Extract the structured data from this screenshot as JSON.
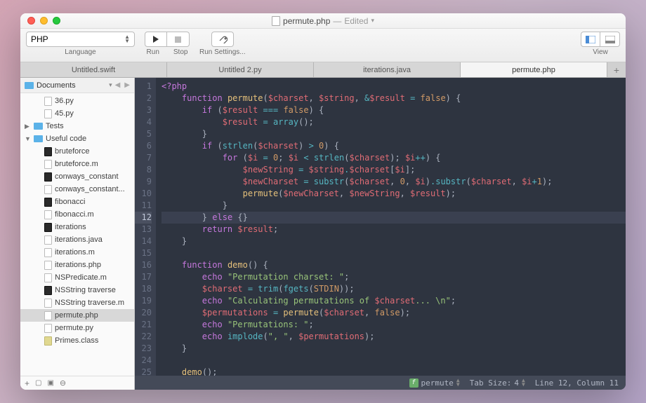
{
  "window": {
    "filename": "permute.php",
    "edited_label": "Edited"
  },
  "toolbar": {
    "language": {
      "selected": "PHP",
      "label": "Language"
    },
    "run": {
      "label": "Run"
    },
    "stop": {
      "label": "Stop"
    },
    "run_settings": {
      "label": "Run Settings..."
    },
    "view": {
      "label": "View"
    }
  },
  "tabs": [
    {
      "label": "Untitled.swift",
      "active": false
    },
    {
      "label": "Untitled 2.py",
      "active": false
    },
    {
      "label": "iterations.java",
      "active": false
    },
    {
      "label": "permute.php",
      "active": true
    }
  ],
  "sidebar": {
    "root": "Documents",
    "items": [
      {
        "label": "36.py",
        "type": "doc",
        "depth": 2
      },
      {
        "label": "45.py",
        "type": "doc",
        "depth": 2
      },
      {
        "label": "Tests",
        "type": "folder",
        "depth": 1,
        "expanded": false
      },
      {
        "label": "Useful code",
        "type": "folder",
        "depth": 1,
        "expanded": true
      },
      {
        "label": "bruteforce",
        "type": "exec",
        "depth": 2
      },
      {
        "label": "bruteforce.m",
        "type": "doc",
        "depth": 2
      },
      {
        "label": "conways_constant",
        "type": "exec",
        "depth": 2
      },
      {
        "label": "conways_constant...",
        "type": "doc",
        "depth": 2
      },
      {
        "label": "fibonacci",
        "type": "exec",
        "depth": 2
      },
      {
        "label": "fibonacci.m",
        "type": "doc",
        "depth": 2
      },
      {
        "label": "iterations",
        "type": "exec",
        "depth": 2
      },
      {
        "label": "iterations.java",
        "type": "doc",
        "depth": 2
      },
      {
        "label": "iterations.m",
        "type": "doc",
        "depth": 2
      },
      {
        "label": "iterations.php",
        "type": "doc",
        "depth": 2
      },
      {
        "label": "NSPredicate.m",
        "type": "doc",
        "depth": 2
      },
      {
        "label": "NSString traverse",
        "type": "exec",
        "depth": 2
      },
      {
        "label": "NSString traverse.m",
        "type": "doc",
        "depth": 2
      },
      {
        "label": "permute.php",
        "type": "doc",
        "depth": 2,
        "selected": true
      },
      {
        "label": "permute.py",
        "type": "doc",
        "depth": 2
      },
      {
        "label": "Primes.class",
        "type": "class",
        "depth": 2
      }
    ]
  },
  "editor": {
    "line_count": 26,
    "current_line": 12
  },
  "statusbar": {
    "symbol": "permute",
    "tab_size_label": "Tab Size:",
    "tab_size_value": "4",
    "cursor": "Line 12, Column 11"
  }
}
